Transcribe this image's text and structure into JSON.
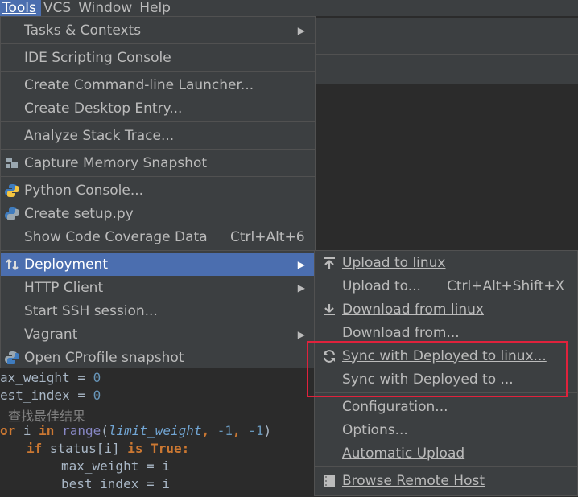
{
  "menubar": {
    "items": [
      {
        "label": "Tools"
      },
      {
        "label": "VCS"
      },
      {
        "label": "Window"
      },
      {
        "label": "Help"
      }
    ]
  },
  "tools_menu": {
    "items": [
      {
        "label": "Tasks & Contexts",
        "submenu": true
      },
      {
        "label": "IDE Scripting Console"
      },
      {
        "label": "Create Command-line Launcher..."
      },
      {
        "label": "Create Desktop Entry..."
      },
      {
        "label": "Analyze Stack Trace..."
      },
      {
        "label": "Capture Memory Snapshot",
        "icon": "memory-snapshot-icon"
      },
      {
        "label": "Python Console...",
        "icon": "python-icon"
      },
      {
        "label": "Create setup.py",
        "icon": "python-setup-icon"
      },
      {
        "label": "Show Code Coverage Data",
        "shortcut": "Ctrl+Alt+6"
      },
      {
        "label": "Deployment",
        "icon": "deployment-icon",
        "submenu": true,
        "active": true
      },
      {
        "label": "HTTP Client",
        "submenu": true
      },
      {
        "label": "Start SSH session..."
      },
      {
        "label": "Vagrant",
        "submenu": true
      },
      {
        "label": "Open CProfile snapshot",
        "icon": "cprofile-icon"
      }
    ]
  },
  "deployment_menu": {
    "items": [
      {
        "label": "Upload to linux",
        "icon": "upload-icon"
      },
      {
        "label": "Upload to...",
        "shortcut": "Ctrl+Alt+Shift+X"
      },
      {
        "label": "Download from linux",
        "icon": "download-icon"
      },
      {
        "label": "Download from..."
      },
      {
        "label": "Sync with Deployed to linux...",
        "icon": "sync-icon"
      },
      {
        "label": "Sync with Deployed to ..."
      },
      {
        "label": "Configuration..."
      },
      {
        "label": "Options..."
      },
      {
        "label": "Automatic Upload"
      },
      {
        "label": "Browse Remote Host",
        "icon": "remote-host-icon"
      }
    ]
  },
  "code": {
    "line1": {
      "a": "ax_weight",
      "b": " = ",
      "c": "0"
    },
    "line2": {
      "a": "est_index",
      "b": " = ",
      "c": "0"
    },
    "line3": {
      "a": "查找最佳结果"
    },
    "line4": {
      "kw1": "or",
      "v1": " i ",
      "kw2": "in",
      "sp": " ",
      "fn": "range",
      "p1": "(",
      "param": "limit_weight",
      "c1": ", ",
      "n1": "-1",
      "c2": ", ",
      "n2": "-1",
      "p2": ")"
    },
    "line5": {
      "kw1": "if",
      "v1": " status[i] ",
      "kw2": "is",
      "sp": " ",
      "kw3": "True",
      "colon": ":"
    },
    "line6": {
      "a": "max_weight",
      "b": " = ",
      "c": "i"
    },
    "line7": {
      "a": "best_index",
      "b": " = ",
      "c": "i"
    }
  },
  "colors": {
    "menu_bg": "#3c3f41",
    "selection": "#4b6eaf",
    "highlight_box": "#e0223c",
    "editor_bg": "#2b2b2b"
  }
}
